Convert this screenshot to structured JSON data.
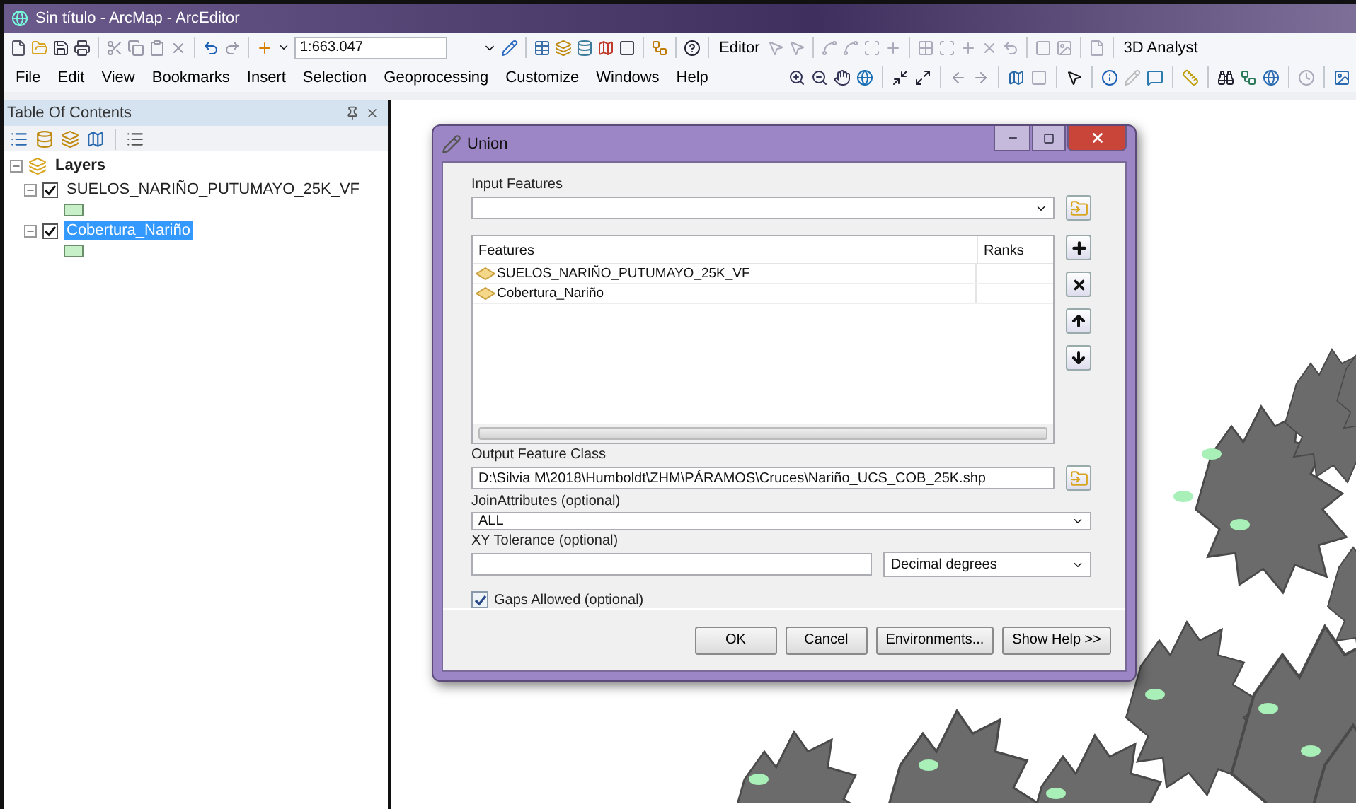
{
  "window": {
    "title": "Sin título - ArcMap - ArcEditor"
  },
  "toolbar": {
    "scale": "1:663.047",
    "editor_menu": "Editor",
    "analyst_menu": "3D Analyst"
  },
  "menu_bar": [
    "File",
    "Edit",
    "View",
    "Bookmarks",
    "Insert",
    "Selection",
    "Geoprocessing",
    "Customize",
    "Windows",
    "Help"
  ],
  "table_of_contents": {
    "title": "Table Of Contents",
    "group": {
      "label": "Layers",
      "expanded": true,
      "children": [
        {
          "label": "SUELOS_NARIÑO_PUTUMAYO_25K_VF",
          "checked": true,
          "expanded": true,
          "selected": false
        },
        {
          "label": "Cobertura_Nariño",
          "checked": true,
          "expanded": true,
          "selected": true
        }
      ]
    }
  },
  "dialog": {
    "title": "Union",
    "input_features": {
      "label": "Input Features"
    },
    "features_table": {
      "columns": [
        "Features",
        "Ranks"
      ],
      "rows": [
        {
          "feature": "SUELOS_NARIÑO_PUTUMAYO_25K_VF"
        },
        {
          "feature": "Cobertura_Nariño"
        }
      ]
    },
    "output": {
      "label": "Output Feature Class",
      "value": "D:\\Silvia M\\2018\\Humboldt\\ZHM\\PÁRAMOS\\Cruces\\Nariño_UCS_COB_25K.shp"
    },
    "join": {
      "label": "JoinAttributes (optional)",
      "value": "ALL"
    },
    "tolerance": {
      "label": "XY Tolerance (optional)",
      "unit": "Decimal degrees"
    },
    "gaps": {
      "label": "Gaps Allowed (optional)",
      "checked": true
    },
    "buttons": [
      "OK",
      "Cancel",
      "Environments...",
      "Show Help >>"
    ]
  }
}
